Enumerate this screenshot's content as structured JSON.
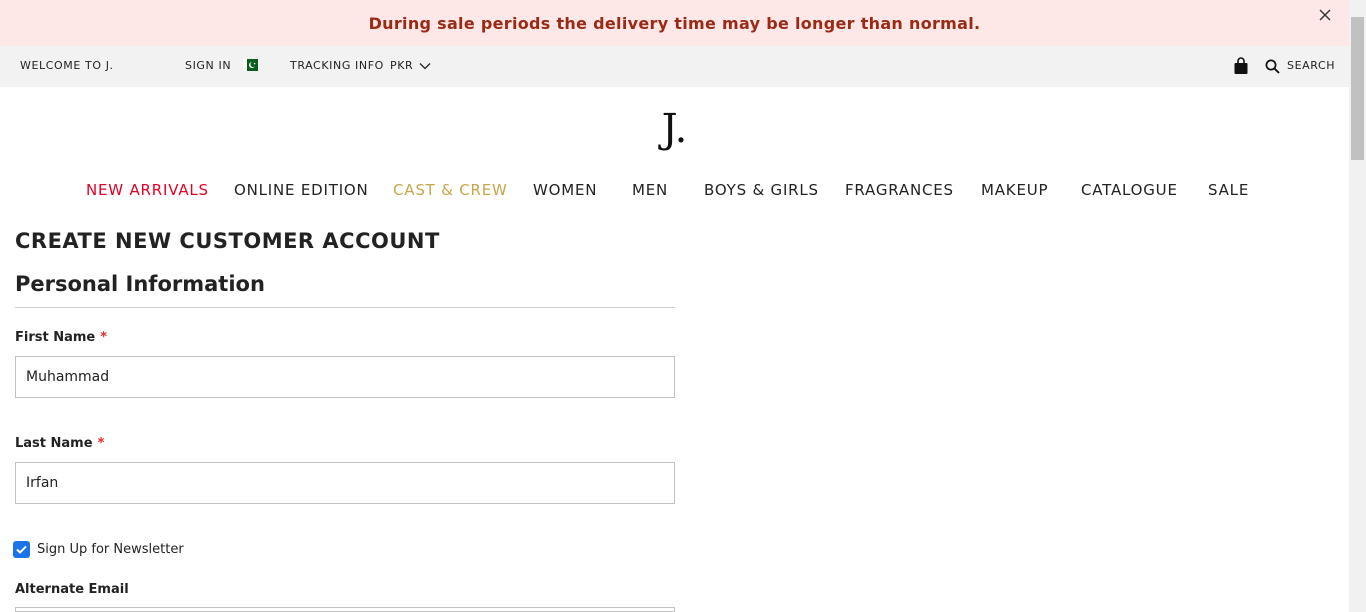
{
  "notice": {
    "text": "During sale periods the delivery time may be longer than normal."
  },
  "topbar": {
    "welcome": "WELCOME TO J.",
    "sign_in": "SIGN IN",
    "tracking": "TRACKING INFO",
    "currency": "PKR",
    "search": "SEARCH"
  },
  "logo": {
    "text": "J."
  },
  "nav": {
    "items": [
      {
        "label": "NEW ARRIVALS",
        "color": "#e60026"
      },
      {
        "label": "ONLINE EDITION",
        "color": "#222222"
      },
      {
        "label": "CAST & CREW",
        "color": "#c9a54b"
      },
      {
        "label": "WOMEN",
        "color": "#222222"
      },
      {
        "label": "MEN",
        "color": "#222222"
      },
      {
        "label": "BOYS & GIRLS",
        "color": "#222222"
      },
      {
        "label": "FRAGRANCES",
        "color": "#222222"
      },
      {
        "label": "MAKEUP",
        "color": "#222222"
      },
      {
        "label": "CATALOGUE",
        "color": "#222222"
      },
      {
        "label": "SALE",
        "color": "#222222"
      }
    ]
  },
  "form": {
    "page_title": "CREATE NEW CUSTOMER ACCOUNT",
    "section_title": "Personal Information",
    "first_name_label": "First Name",
    "first_name_value": "Muhammad",
    "last_name_label": "Last Name",
    "last_name_value": "Irfan",
    "required_mark": "*",
    "newsletter_label": "Sign Up for Newsletter",
    "newsletter_checked": true,
    "alternate_email_label": "Alternate Email"
  },
  "icons": {
    "close": "close-icon",
    "flag": "pakistan-flag-icon",
    "chevron": "chevron-down-icon",
    "bag": "shopping-bag-icon",
    "search": "search-icon"
  }
}
